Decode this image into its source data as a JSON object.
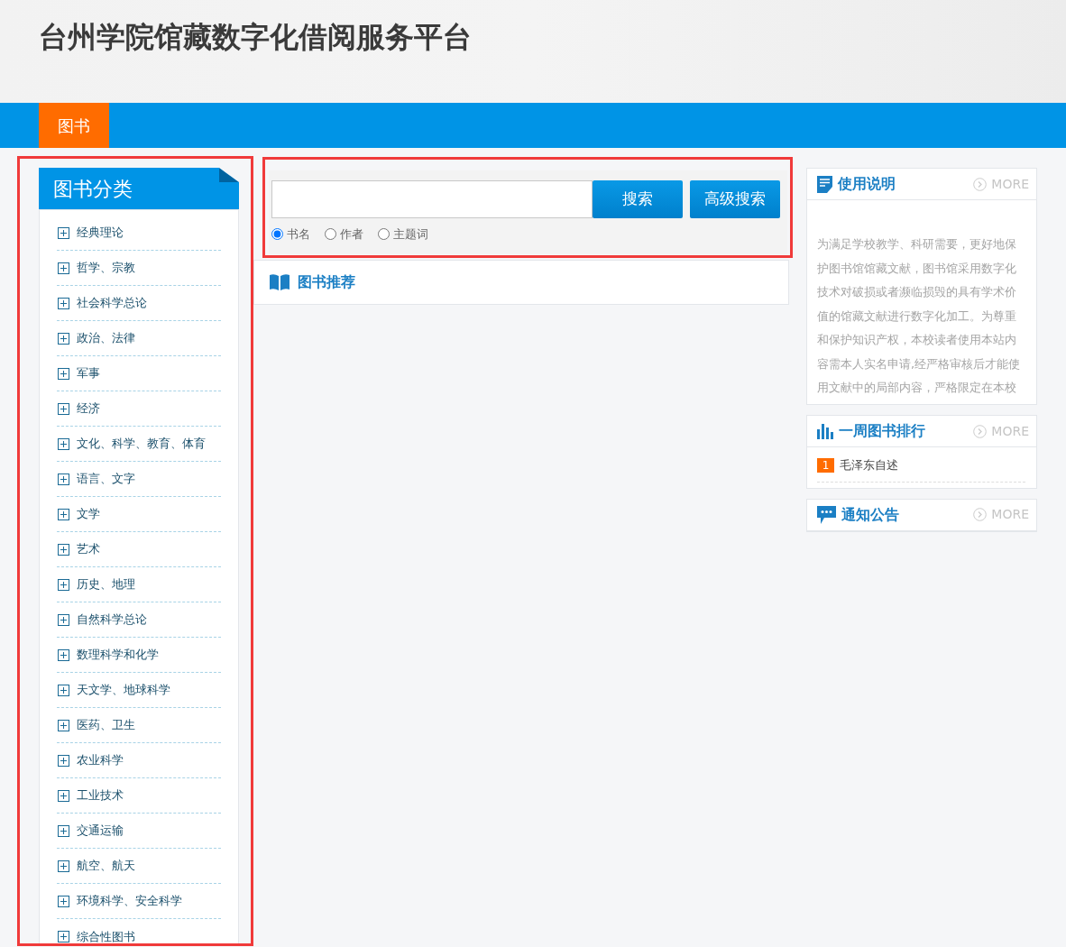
{
  "header": {
    "title": "台州学院馆藏数字化借阅服务平台"
  },
  "nav": [
    {
      "label": "图书",
      "selected": true
    }
  ],
  "sidebar": {
    "title": "图书分类",
    "items": [
      {
        "label": "经典理论",
        "expanded": false
      },
      {
        "label": "哲学、宗教",
        "expanded": false
      },
      {
        "label": "社会科学总论",
        "expanded": false
      },
      {
        "label": "政治、法律",
        "expanded": false
      },
      {
        "label": "军事",
        "expanded": false
      },
      {
        "label": "经济",
        "expanded": false
      },
      {
        "label": "文化、科学、教育、体育",
        "expanded": false
      },
      {
        "label": "语言、文字",
        "expanded": false
      },
      {
        "label": "文学",
        "expanded": false
      },
      {
        "label": "艺术",
        "expanded": false
      },
      {
        "label": "历史、地理",
        "expanded": false
      },
      {
        "label": "自然科学总论",
        "expanded": false
      },
      {
        "label": "数理科学和化学",
        "expanded": false
      },
      {
        "label": "天文学、地球科学",
        "expanded": false
      },
      {
        "label": "医药、卫生",
        "expanded": false
      },
      {
        "label": "农业科学",
        "expanded": false
      },
      {
        "label": "工业技术",
        "expanded": false
      },
      {
        "label": "交通运输",
        "expanded": false
      },
      {
        "label": "航空、航天",
        "expanded": false
      },
      {
        "label": "环境科学、安全科学",
        "expanded": false
      },
      {
        "label": "综合性图书",
        "expanded": false
      }
    ]
  },
  "search": {
    "buttons": [
      "搜索",
      "高级搜索"
    ],
    "options": [
      {
        "label": "书名",
        "selected": true
      },
      {
        "label": "作者",
        "selected": false
      },
      {
        "label": "主题词",
        "selected": false
      }
    ]
  },
  "recommend": {
    "title": "图书推荐"
  },
  "panels": [
    {
      "kind": "text",
      "title": "使用说明",
      "more": "MORE",
      "text": "为满足学校教学、科研需要，更好地保护图书馆馆藏文献，图书馆采用数字化技术对破损或者濒临损毁的具有学术价值的馆藏文献进行数字化加工。为尊重和保护知识产权，本校读者使用本站内容需本人实名申请,经严格审核后才能使用文献中的局部内容，严格限定在本校"
    },
    {
      "kind": "ranking",
      "title": "一周图书排行",
      "more": "MORE",
      "items": [
        {
          "rank": "1",
          "title": "毛泽东自述"
        }
      ]
    },
    {
      "kind": "notice",
      "title": "通知公告",
      "more": "MORE"
    }
  ]
}
